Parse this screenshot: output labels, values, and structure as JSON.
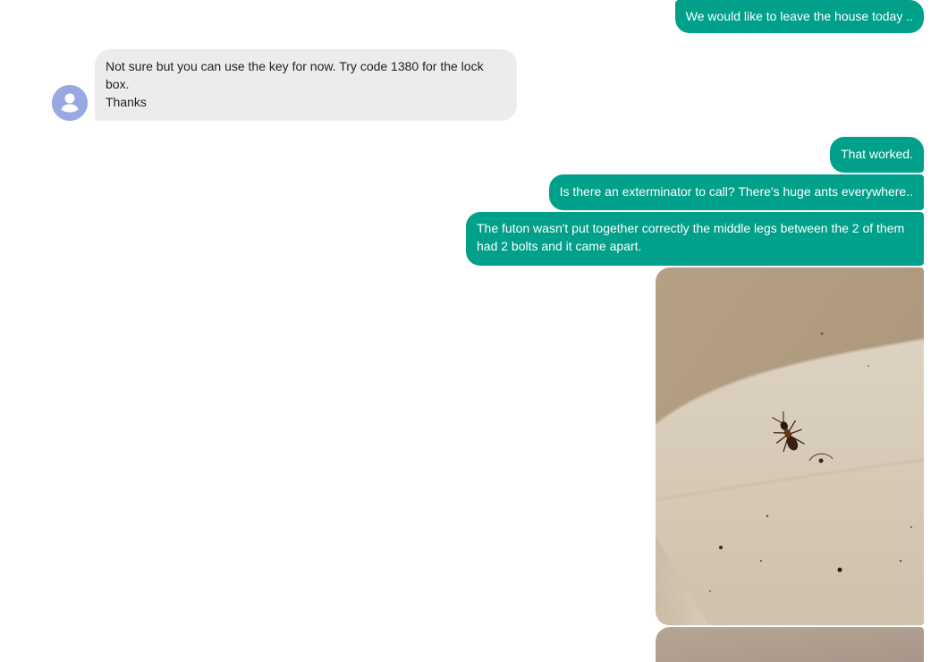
{
  "messages": {
    "m1": {
      "text": "We would like to leave the house today ..",
      "direction": "outgoing"
    },
    "m2": {
      "text": " Not sure but you can use the key for now. Try code 1380 for the lock box.\nThanks",
      "direction": "incoming"
    },
    "m3": {
      "text": "That worked.",
      "direction": "outgoing"
    },
    "m4": {
      "text": "Is there an exterminator to call? There's huge ants everywhere..",
      "direction": "outgoing"
    },
    "m5": {
      "text": "The futon wasn't put together correctly the middle legs between the 2 of them had 2 bolts and it came apart.",
      "direction": "outgoing"
    }
  },
  "avatar": {
    "icon": "person-icon",
    "color": "#98a8e0"
  },
  "colors": {
    "outgoing_bubble": "#00a08a",
    "incoming_bubble": "#ececec",
    "photo_background": "#b8a082"
  },
  "photos": {
    "p1": {
      "icon": "ant-photo",
      "subject": "ant on white surface"
    },
    "p2": {
      "icon": "photo-thumbnail"
    }
  }
}
